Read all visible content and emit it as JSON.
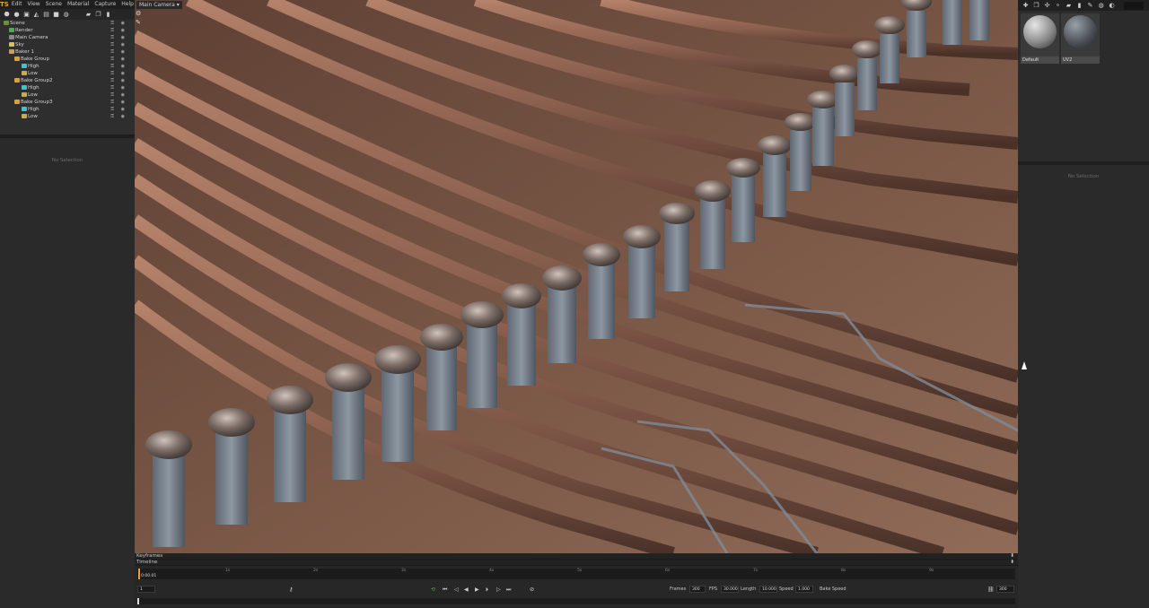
{
  "app": {
    "logo": "TS"
  },
  "menu": [
    "Edit",
    "View",
    "Scene",
    "Material",
    "Capture",
    "Help"
  ],
  "viewport": {
    "camera_label": "Main Camera"
  },
  "outliner": {
    "rows": [
      {
        "label": "Scene",
        "icon": "scene"
      },
      {
        "label": "Render",
        "icon": "render"
      },
      {
        "label": "Main Camera",
        "icon": "cam"
      },
      {
        "label": "Sky",
        "icon": "sky"
      },
      {
        "label": "Baker 1",
        "icon": "bake"
      },
      {
        "label": "Bake Group",
        "icon": "folder"
      },
      {
        "label": "High",
        "icon": "mesh"
      },
      {
        "label": "Low",
        "icon": "meshy"
      },
      {
        "label": "Bake Group2",
        "icon": "folder"
      },
      {
        "label": "High",
        "icon": "mesh"
      },
      {
        "label": "Low",
        "icon": "meshy"
      },
      {
        "label": "Bake Group3",
        "icon": "folder"
      },
      {
        "label": "High",
        "icon": "mesh"
      },
      {
        "label": "Low",
        "icon": "meshy"
      }
    ]
  },
  "left_props": {
    "empty_label": "No Selection"
  },
  "right_props": {
    "empty_label": "No Selection"
  },
  "materials": [
    {
      "label": "Default",
      "style": "plain"
    },
    {
      "label": "UV2",
      "style": "textured"
    }
  ],
  "timeline": {
    "keyframes_label": "Keyframes",
    "timeline_label": "Timeline",
    "ticks": [
      "1s",
      "2s",
      "3s",
      "4s",
      "5s",
      "6s",
      "7s",
      "8s",
      "9s"
    ],
    "current_time": "0:00.01",
    "current_frame": "1",
    "frames_label": "Frames",
    "frames_value": "300",
    "fps_label": "FPS",
    "fps_value": "30.000",
    "length_label": "Length",
    "length_value": "10.000",
    "speed_label": "Speed",
    "speed_value": "1.000",
    "bake_speed_label": "Bake Speed",
    "end_frame": "300"
  },
  "colors": {
    "accent": "#e8a13a",
    "play_green": "#3db34a"
  }
}
